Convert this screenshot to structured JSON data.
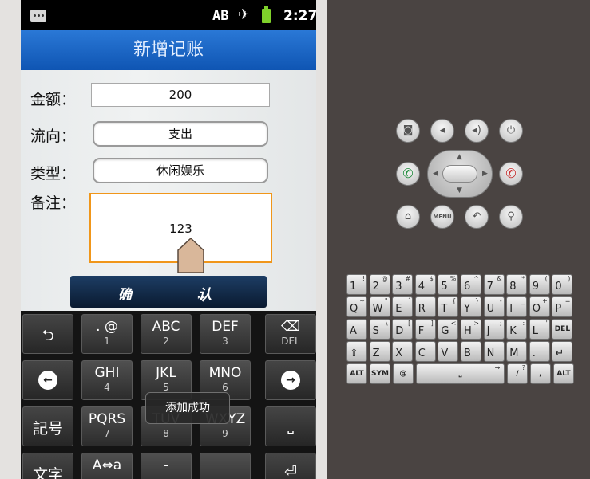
{
  "status_bar": {
    "notification_icon": "message-icon",
    "ab_indicator": "AB",
    "airplane_icon": "airplane-icon",
    "battery_icon": "battery-charging-icon",
    "time": "2:27"
  },
  "app": {
    "title": "新增记账",
    "fields": {
      "amount": {
        "label": "金额：",
        "value": "200"
      },
      "flow": {
        "label": "流向：",
        "value": "支出"
      },
      "type": {
        "label": "类型：",
        "value": "休闲娱乐"
      },
      "note": {
        "label": "备注：",
        "value": "123"
      }
    },
    "confirm": {
      "char1": "确",
      "char2": "认"
    }
  },
  "ime": {
    "rows": [
      [
        {
          "name": "undo",
          "one": "⮌"
        },
        {
          "main": ". @",
          "sub": "1"
        },
        {
          "main": "ABC",
          "sub": "2"
        },
        {
          "main": "DEF",
          "sub": "3"
        },
        {
          "name": "delete",
          "main": "⌫",
          "sub": "DEL"
        }
      ],
      [
        {
          "name": "left",
          "circ": "←"
        },
        {
          "main": "GHI",
          "sub": "4"
        },
        {
          "main": "JKL",
          "sub": "5"
        },
        {
          "main": "MNO",
          "sub": "6"
        },
        {
          "name": "right",
          "circ": "→"
        }
      ],
      [
        {
          "name": "symbol",
          "one": "記号"
        },
        {
          "main": "PQRS",
          "sub": "7"
        },
        {
          "main": "TUV",
          "sub": "8"
        },
        {
          "main": "WXYZ",
          "sub": "9"
        },
        {
          "name": "space",
          "one": "⎵"
        }
      ],
      [
        {
          "name": "mode",
          "one": "文字"
        },
        {
          "main": "A⇔a",
          "sub": ""
        },
        {
          "main": "-",
          "sub": ""
        },
        {
          "main": "",
          "sub": ""
        },
        {
          "name": "enter",
          "one": "⏎"
        }
      ]
    ],
    "toast": "添加成功"
  },
  "emulator": {
    "top_buttons": [
      {
        "name": "camera",
        "glyph": "◙"
      },
      {
        "name": "volume-down",
        "glyph": "◂"
      },
      {
        "name": "volume-up",
        "glyph": "◂)"
      },
      {
        "name": "power",
        "glyph": "⏻"
      }
    ],
    "call_buttons": [
      {
        "name": "call",
        "glyph": "✆",
        "color": "#1e8a3a"
      },
      {
        "name": "end-call",
        "glyph": "✆",
        "color": "#c62828"
      }
    ],
    "bottom_buttons": [
      {
        "name": "home",
        "glyph": "⌂"
      },
      {
        "name": "menu",
        "glyph": "MENU"
      },
      {
        "name": "back",
        "glyph": "↶"
      },
      {
        "name": "search",
        "glyph": "⚲"
      }
    ],
    "keyboard": {
      "row1": [
        [
          "1",
          "!"
        ],
        [
          "2",
          "@"
        ],
        [
          "3",
          "#"
        ],
        [
          "4",
          "$"
        ],
        [
          "5",
          "%"
        ],
        [
          "6",
          "^"
        ],
        [
          "7",
          "&"
        ],
        [
          "8",
          "*"
        ],
        [
          "9",
          "("
        ],
        [
          "0",
          ")"
        ]
      ],
      "row2": [
        [
          "Q",
          "~"
        ],
        [
          "W",
          "\""
        ],
        [
          "E",
          "´"
        ],
        [
          "R",
          ""
        ],
        [
          "T",
          "{"
        ],
        [
          "Y",
          "}"
        ],
        [
          "U",
          "-"
        ],
        [
          "I",
          "_"
        ],
        [
          "O",
          "+"
        ],
        [
          "P",
          "="
        ]
      ],
      "row3": [
        [
          "A",
          ""
        ],
        [
          "S",
          "\\"
        ],
        [
          "D",
          "["
        ],
        [
          "F",
          "]"
        ],
        [
          "G",
          "<"
        ],
        [
          "H",
          ">"
        ],
        [
          "J",
          ";"
        ],
        [
          "K",
          ":"
        ],
        [
          "L",
          "'"
        ],
        [
          "DEL",
          ""
        ]
      ],
      "row4": [
        [
          "⇧",
          ""
        ],
        [
          "Z",
          ""
        ],
        [
          "X",
          ""
        ],
        [
          "C",
          ""
        ],
        [
          "V",
          ""
        ],
        [
          "B",
          ""
        ],
        [
          "N",
          ""
        ],
        [
          "M",
          ""
        ],
        [
          ".",
          ""
        ],
        [
          "↵",
          ""
        ]
      ],
      "row5": [
        [
          "ALT",
          ""
        ],
        [
          "SYM",
          ""
        ],
        [
          "@",
          ""
        ],
        [
          "⎵",
          "→|"
        ],
        [
          "/",
          "?"
        ],
        [
          ",",
          ""
        ],
        [
          "ALT",
          ""
        ]
      ]
    }
  }
}
